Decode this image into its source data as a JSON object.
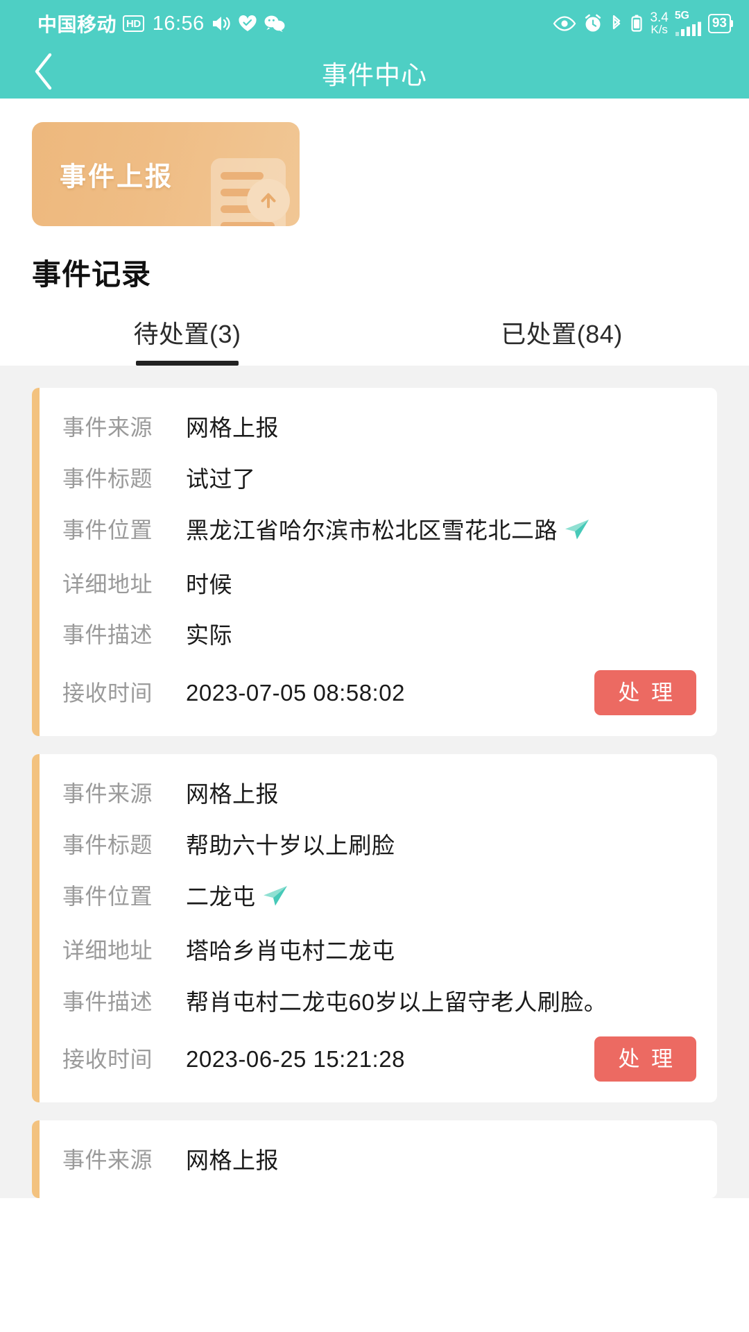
{
  "statusbar": {
    "carrier": "中国移动",
    "hd_badge": "HD",
    "time": "16:56",
    "icons_left": [
      "volume-icon",
      "heart-icon",
      "wechat-icon"
    ],
    "icons_right": [
      "eye-icon",
      "alarm-icon",
      "bluetooth-icon",
      "battery-saver-icon"
    ],
    "net_speed_value": "3.4",
    "net_speed_unit": "K/s",
    "net_type": "5G",
    "signal_icon": "signal-bars-icon",
    "battery_level": "93"
  },
  "header": {
    "back_icon": "chevron-left-icon",
    "title": "事件中心",
    "accent_color": "#4ecfc4"
  },
  "banner": {
    "title": "事件上报",
    "icon": "document-upload-icon",
    "color_start": "#edb87d",
    "color_end": "#f1c795"
  },
  "section": {
    "title": "事件记录"
  },
  "tabs": [
    {
      "label": "待处置(3)",
      "active": true
    },
    {
      "label": "已处置(84)",
      "active": false
    }
  ],
  "field_labels": {
    "source": "事件来源",
    "title": "事件标题",
    "location": "事件位置",
    "address": "详细地址",
    "description": "事件描述",
    "receive_time": "接收时间"
  },
  "action": {
    "handle_label": "处 理",
    "button_color": "#ec6a62"
  },
  "card_accent_color": "#f3c27f",
  "nav_icon_color": "#5fd0c0",
  "events": [
    {
      "source": "网格上报",
      "title": "试过了",
      "location": "黑龙江省哈尔滨市松北区雪花北二路",
      "address": "时候",
      "description": "实际",
      "receive_time": "2023-07-05 08:58:02"
    },
    {
      "source": "网格上报",
      "title": "帮助六十岁以上刷脸",
      "location": "二龙屯",
      "address": "塔哈乡肖屯村二龙屯",
      "description": "帮肖屯村二龙屯60岁以上留守老人刷脸。",
      "receive_time": "2023-06-25 15:21:28"
    },
    {
      "source": "网格上报"
    }
  ]
}
